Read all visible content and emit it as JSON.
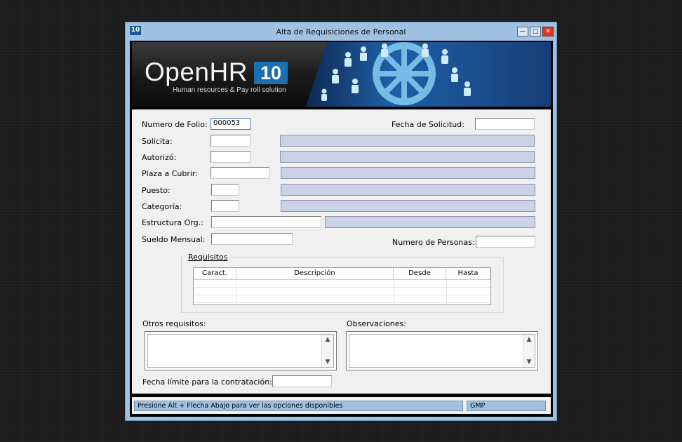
{
  "window": {
    "title": "Alta de Requisiciones de Personal",
    "app_icon_text": "10",
    "min_label": "—",
    "max_label": "□",
    "close_label": "✕"
  },
  "banner": {
    "logo_text": "OpenHR",
    "logo_number": "10",
    "subtitle": "Human resources & Pay roll solution",
    "accent_color": "#1d6fb3"
  },
  "form": {
    "folio_label": "Numero de Folio:",
    "folio_value": "000053",
    "fecha_solicitud_label": "Fecha de Solicitud:",
    "fecha_solicitud_value": "",
    "solicita_label": "Solicita:",
    "autorizo_label": "Autorizó:",
    "plaza_label": "Plaza a Cubrir:",
    "puesto_label": "Puesto:",
    "categoria_label": "Categoría:",
    "estructura_label": "Estructura Org.:",
    "sueldo_label": "Sueldo Mensual:",
    "num_personas_label": "Numero de Personas:",
    "requisitos_title": "Requisitos",
    "grid_headers": [
      "Caract.",
      "Descripción",
      "Desde",
      "Hasta"
    ],
    "otros_label": "Otros requisitos:",
    "observaciones_label": "Observaciones:",
    "fecha_limite_label": "Fecha límite para la contratación:"
  },
  "status": {
    "hint": "Presione Alt + Flecha Abajo para ver las opciones disponibles",
    "user": "GMP"
  }
}
